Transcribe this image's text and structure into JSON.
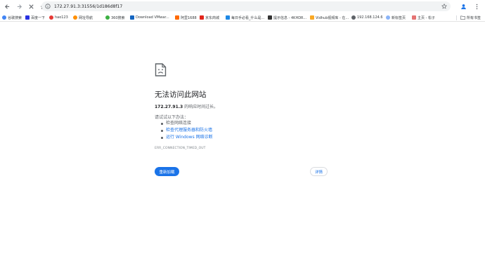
{
  "toolbar": {
    "url": "172.27.91.3:31556/1d186d8f17"
  },
  "bookmarks": {
    "items": [
      {
        "label": "谷歌搜索",
        "color": "#4285f4",
        "round": true
      },
      {
        "label": "百度一下",
        "color": "#2932e1",
        "round": false
      },
      {
        "label": "hao123",
        "color": "#e53935",
        "round": true
      },
      {
        "label": "网址导航",
        "color": "#ff8f00",
        "round": true
      },
      {
        "label": "360搜索",
        "color": "#3cb043",
        "round": true
      },
      {
        "label": "Download VMwar...",
        "color": "#1565c0",
        "round": false
      },
      {
        "label": "阿里1688",
        "color": "#ff6a00",
        "round": false
      },
      {
        "label": "京东商城",
        "color": "#e1251b",
        "round": false
      },
      {
        "label": "每日手必看_什么是...",
        "color": "#1e88e5",
        "round": false
      },
      {
        "label": "提示信息 - 4KHDR...",
        "color": "#333333",
        "round": false
      },
      {
        "label": "Vidhub视频库 - 在...",
        "color": "#f9a825",
        "round": false
      },
      {
        "label": "192.168.124.6",
        "color": "#5f6368",
        "round": true
      },
      {
        "label": "新标签页",
        "color": "#8ab4f8",
        "round": true
      },
      {
        "label": "主页 - 松子",
        "color": "#e57373",
        "round": false
      }
    ],
    "all_bookmarks": "所有书签"
  },
  "error_page": {
    "title": "无法访问此网站",
    "host": "172.27.91.3",
    "subtitle_rest": " 的响应时间过长。",
    "try_label": "请试试以下办法：",
    "suggestions": [
      {
        "text": "检查网络连接",
        "link": false
      },
      {
        "text": "检查代理服务器和防火墙",
        "link": true
      },
      {
        "text": "运行 Windows 网络诊断",
        "link": true
      }
    ],
    "error_code": "ERR_CONNECTION_TIMED_OUT",
    "reload_label": "重新加载",
    "details_label": "详情"
  },
  "colors": {
    "accent": "#1a73e8",
    "muted_text": "#5f6368",
    "omnibox_bg": "#f1f3f4"
  }
}
